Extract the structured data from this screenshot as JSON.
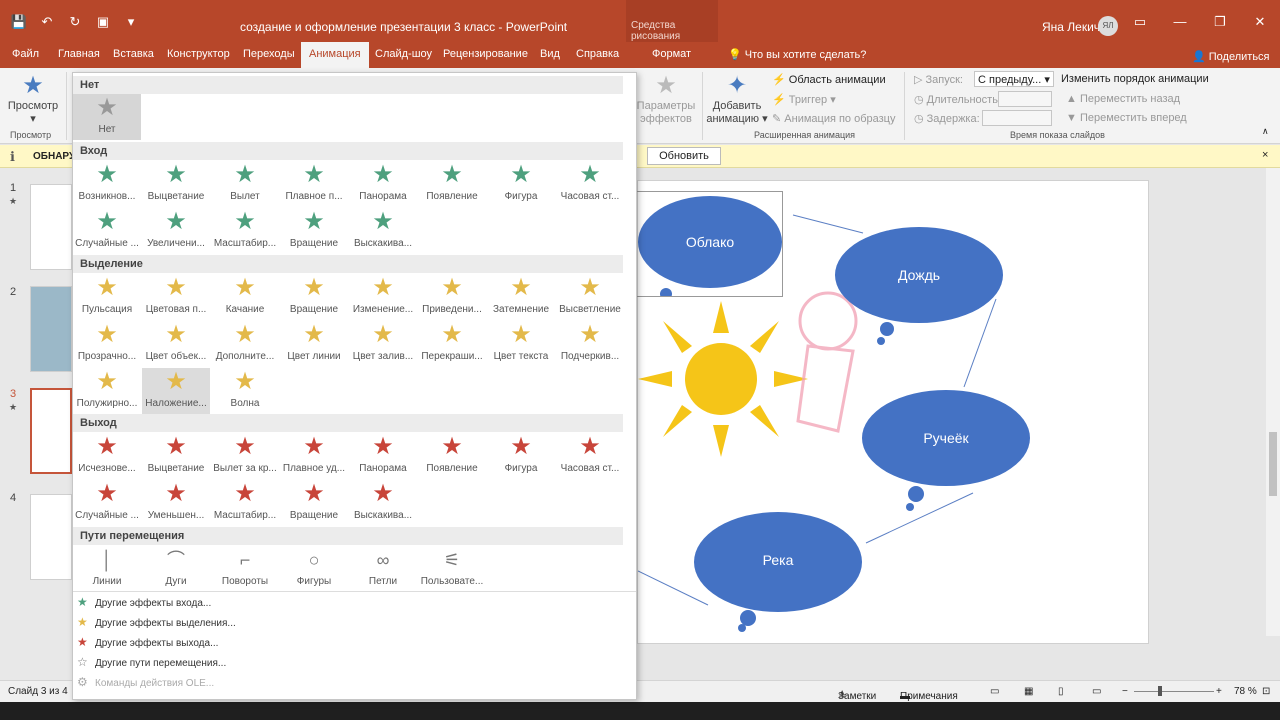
{
  "window": {
    "title": "создание и оформление презентации 3 класс  -  PowerPoint",
    "context_tools": "Средства рисования",
    "user_name": "Яна Лекич",
    "user_initials": "ЯЛ"
  },
  "tabs": [
    "Файл",
    "Главная",
    "Вставка",
    "Конструктор",
    "Переходы",
    "Анимация",
    "Слайд-шоу",
    "Рецензирование",
    "Вид",
    "Справка",
    "Формат"
  ],
  "tell_me": "Что вы хотите сделать?",
  "share": "Поделиться",
  "ribbon": {
    "preview": "Просмотр",
    "preview_group": "Просмотр",
    "effect_params": "Параметры эффектов",
    "add_animation": "Добавить анимацию",
    "animation_pane": "Область анимации",
    "trigger": "Триггер",
    "animation_painter": "Анимация по образцу",
    "advanced_group": "Расширенная анимация",
    "start_label": "Запуск:",
    "start_value": "С предыду...",
    "duration_label": "Длительность:",
    "delay_label": "Задержка:",
    "reorder": "Изменить порядок анимации",
    "move_earlier": "Переместить назад",
    "move_later": "Переместить вперед",
    "timing_group": "Время показа слайдов"
  },
  "notification": {
    "bold": "ОБНАРУ",
    "button": "Обновить",
    "close": "×"
  },
  "gallery": {
    "none_header": "Нет",
    "none_label": "Нет",
    "entrance_header": "Вход",
    "entrance": [
      "Возникнов...",
      "Выцветание",
      "Вылет",
      "Плавное п...",
      "Панорама",
      "Появление",
      "Фигура",
      "Часовая ст...",
      "Случайные ...",
      "Увеличени...",
      "Масштабир...",
      "Вращение",
      "Выскакива..."
    ],
    "emphasis_header": "Выделение",
    "emphasis": [
      "Пульсация",
      "Цветовая п...",
      "Качание",
      "Вращение",
      "Изменение...",
      "Приведени...",
      "Затемнение",
      "Высветление",
      "Прозрачно...",
      "Цвет объек...",
      "Дополните...",
      "Цвет линии",
      "Цвет залив...",
      "Перекраши...",
      "Цвет текста",
      "Подчеркив...",
      "Полужирно...",
      "Наложение...",
      "Волна"
    ],
    "exit_header": "Выход",
    "exit": [
      "Исчезнове...",
      "Выцветание",
      "Вылет за кр...",
      "Плавное уд...",
      "Панорама",
      "Появление",
      "Фигура",
      "Часовая ст...",
      "Случайные ...",
      "Уменьшен...",
      "Масштабир...",
      "Вращение",
      "Выскакива..."
    ],
    "paths_header": "Пути перемещения",
    "paths": [
      "Линии",
      "Дуги",
      "Повороты",
      "Фигуры",
      "Петли",
      "Пользовате..."
    ],
    "more": [
      "Другие эффекты входа...",
      "Другие эффекты выделения...",
      "Другие эффекты выхода...",
      "Другие пути перемещения...",
      "Команды действия OLE..."
    ]
  },
  "slides": {
    "numbers": [
      "1",
      "2",
      "3",
      "4"
    ]
  },
  "slide_clouds": [
    "Облако",
    "Дождь",
    "Ручеёк",
    "Река"
  ],
  "status": {
    "slide_counter": "Слайд 3 из 4",
    "notes": "Заметки",
    "comments": "Примечания",
    "zoom": "78 %"
  },
  "colors": {
    "brand": "#b7472a",
    "entrance": "#4ea07e",
    "emphasis": "#e3b94a",
    "exit": "#c8453a",
    "cloud": "#4472c4"
  }
}
